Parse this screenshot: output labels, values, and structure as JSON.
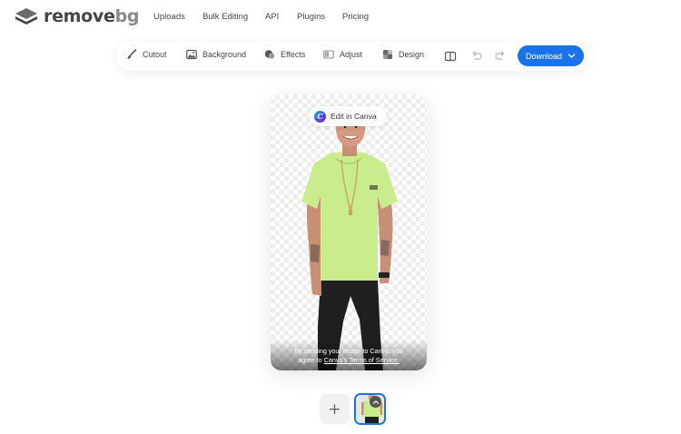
{
  "brand": {
    "name_main": "remove",
    "name_accent": "bg"
  },
  "nav": {
    "links": [
      "Uploads",
      "Bulk Editing",
      "API",
      "Plugins",
      "Pricing"
    ]
  },
  "toolbar": {
    "tools": [
      {
        "label": "Cutout",
        "icon": "brush-icon"
      },
      {
        "label": "Background",
        "icon": "image-icon"
      },
      {
        "label": "Effects",
        "icon": "effects-icon"
      },
      {
        "label": "Adjust",
        "icon": "adjust-icon"
      },
      {
        "label": "Design",
        "icon": "design-icon"
      }
    ],
    "compare_icon": "compare-icon",
    "undo_icon": "undo-icon",
    "redo_icon": "redo-icon",
    "download_label": "Download",
    "accent_color": "#1a73e8"
  },
  "preview": {
    "edit_canva_label": "Edit in Canva",
    "terms_line1": "By sending your image to Canva, you",
    "terms_line2_prefix": "agree to ",
    "terms_link": "Canva's Terms of Service."
  },
  "thumbnails": {
    "add_label": "+"
  }
}
